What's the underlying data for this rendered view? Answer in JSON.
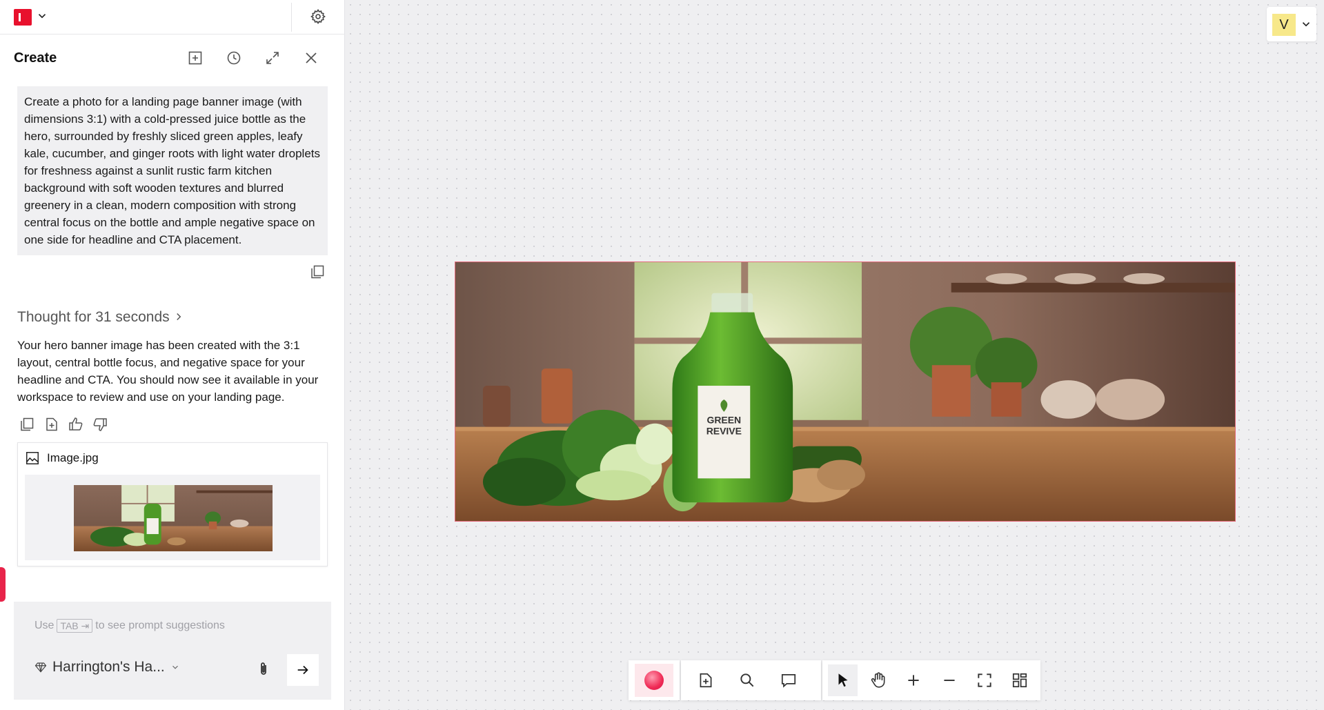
{
  "panel": {
    "title": "Create",
    "prompt": "Create a photo for a landing page banner image (with dimensions 3:1) with a cold-pressed juice bottle as the hero, surrounded by freshly sliced green apples, leafy kale, cucumber, and ginger roots with light water droplets for freshness against a sunlit rustic farm kitchen background with soft wooden textures and blurred greenery in a clean, modern composition with strong central focus on the bottle and ample negative space on one side for headline and CTA placement.",
    "thought": "Thought for 31 seconds",
    "answer": "Your hero banner image has been created with the 3:1 layout, central bottle focus, and negative space for your headline and CTA. You should now see it available in your workspace to review and use on your landing page.",
    "attachment": {
      "filename": "Image.jpg"
    },
    "input": {
      "hint_before": "Use",
      "hint_key": "TAB ⇥",
      "hint_after": "to see prompt suggestions",
      "brand": "Harrington's Ha..."
    }
  },
  "canvas": {
    "avatar_initial": "V",
    "banner_label_line1": "GREEN",
    "banner_label_line2": "REVIVE"
  },
  "colors": {
    "accent": "#e8112d",
    "selection": "#e56a7b",
    "avatar_bg": "#f7e88a"
  }
}
